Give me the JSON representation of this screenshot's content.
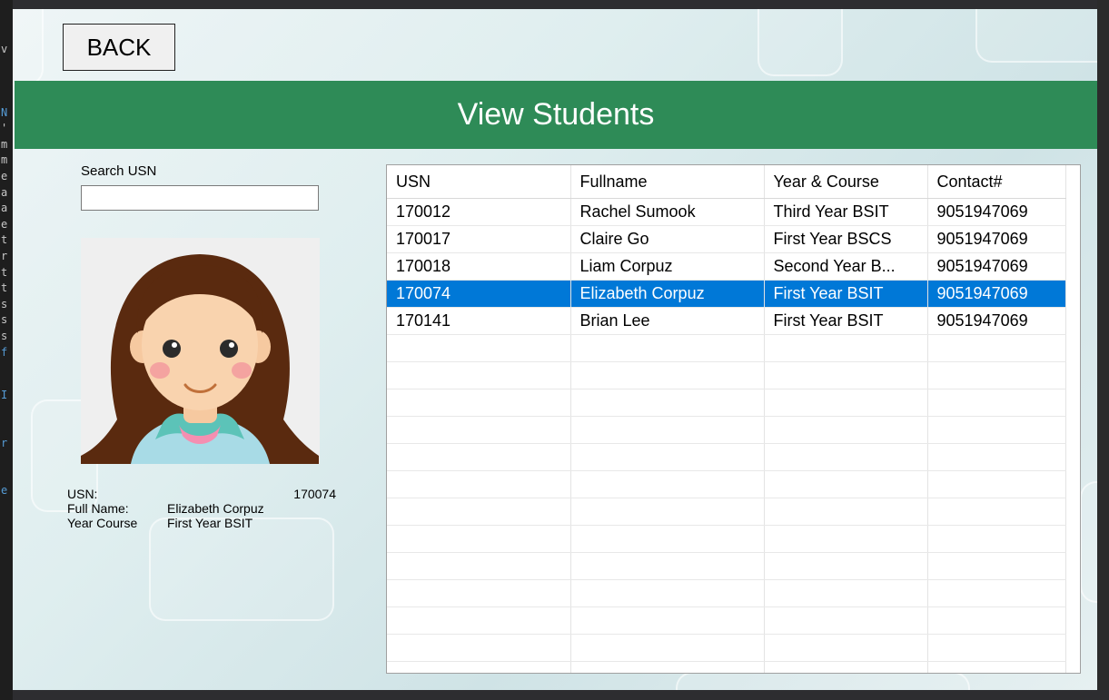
{
  "app": {
    "back_label": "BACK",
    "header_title": "View Students",
    "search": {
      "label": "Search USN",
      "value": "",
      "placeholder": ""
    },
    "details": {
      "usn_label": "USN:",
      "usn_value": "170074",
      "fullname_label": "Full Name:",
      "fullname_value": "Elizabeth Corpuz",
      "yearcourse_label": "Year  Course",
      "yearcourse_value": "First Year BSIT"
    },
    "photo_icon": "girl-avatar-icon"
  },
  "table": {
    "columns": [
      "USN",
      "Fullname",
      "Year & Course",
      "Contact#"
    ],
    "rows": [
      {
        "usn": "170012",
        "fullname": "Rachel Sumook",
        "year_course": "Third Year BSIT",
        "contact": "9051947069"
      },
      {
        "usn": "170017",
        "fullname": "Claire Go",
        "year_course": "First Year BSCS",
        "contact": "9051947069"
      },
      {
        "usn": "170018",
        "fullname": "Liam Corpuz",
        "year_course": "Second Year B...",
        "contact": "9051947069"
      },
      {
        "usn": "170074",
        "fullname": "Elizabeth Corpuz",
        "year_course": "First Year BSIT",
        "contact": "9051947069"
      },
      {
        "usn": "170141",
        "fullname": "Brian Lee",
        "year_course": "First Year BSIT",
        "contact": "9051947069"
      }
    ],
    "selected_index": 3,
    "selection_color": "#0078d7"
  },
  "colors": {
    "header_bg": "#2e8b57",
    "header_text": "#ffffff"
  }
}
